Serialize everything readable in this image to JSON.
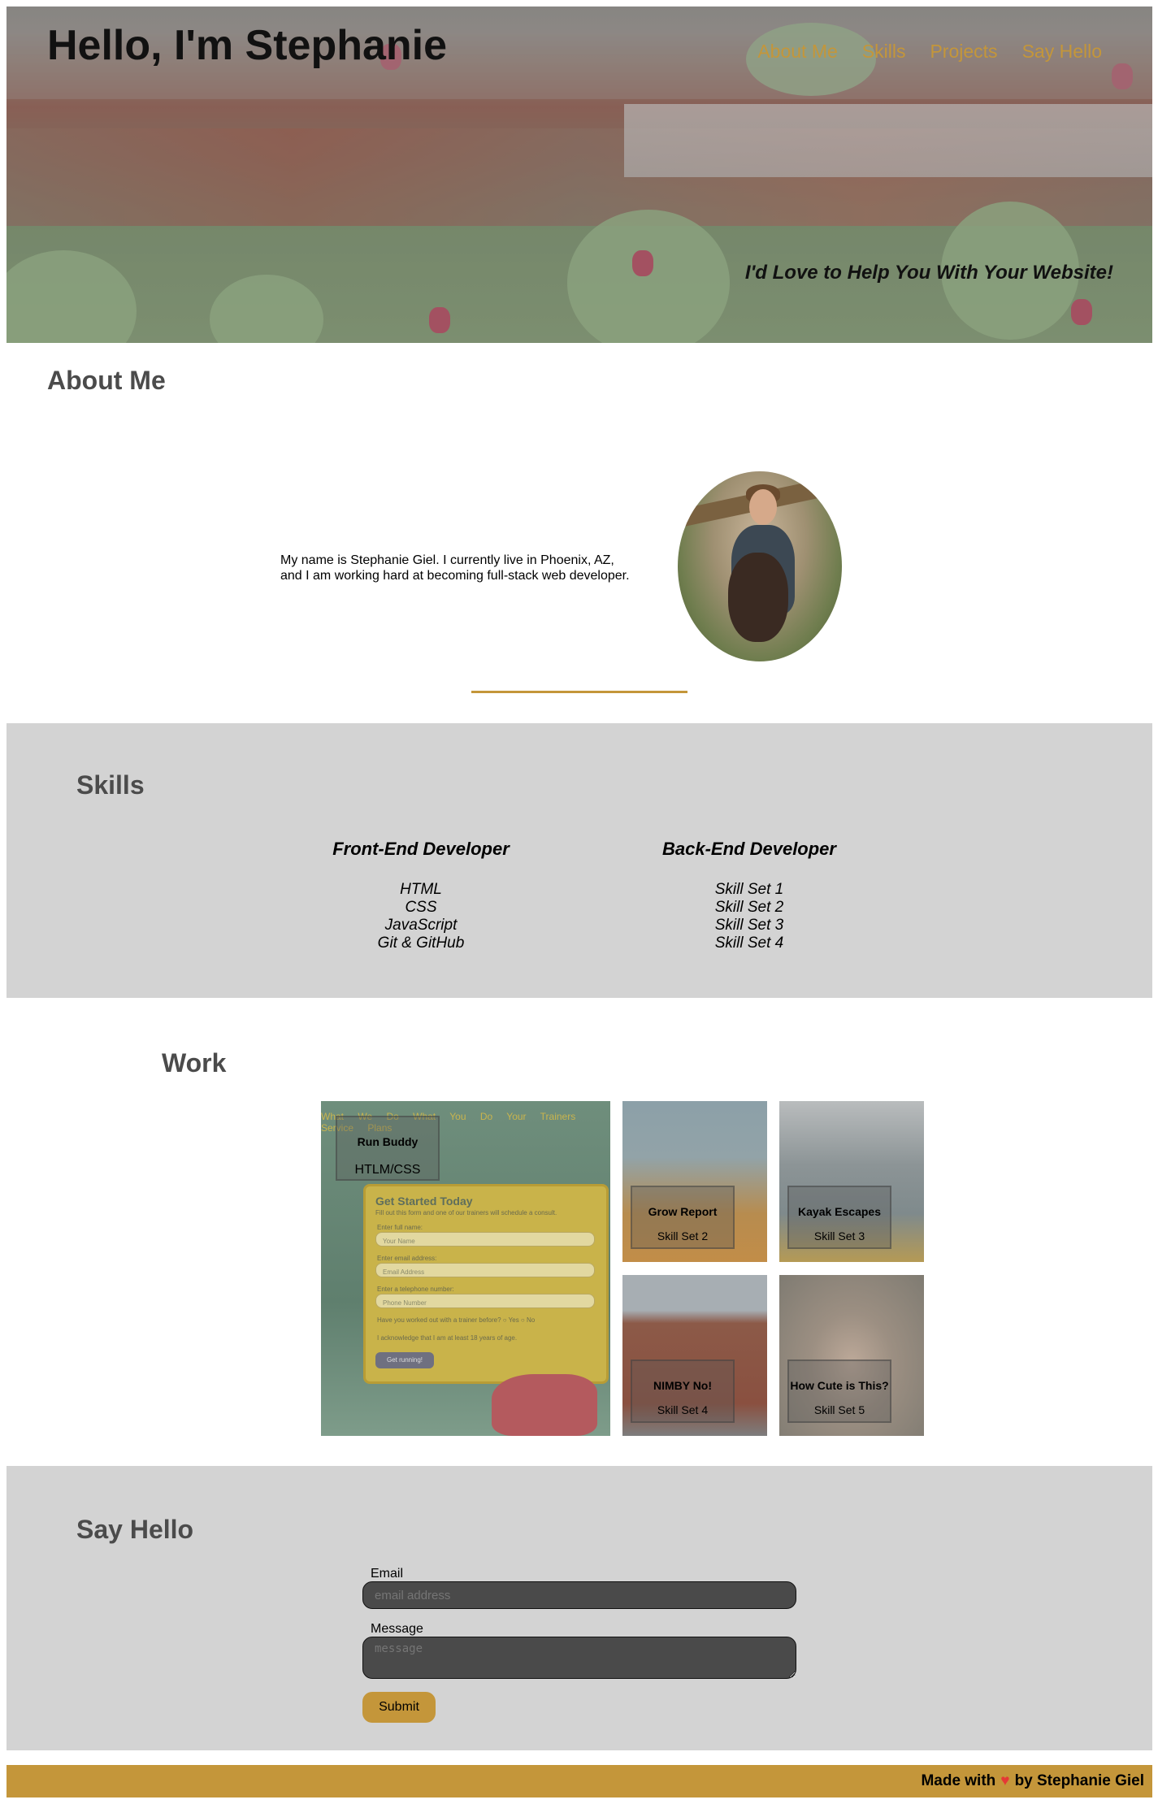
{
  "header": {
    "title": "Hello, I'm Stephanie",
    "nav": [
      "About Me",
      "Skills",
      "Projects",
      "Say Hello"
    ],
    "tagline": "I'd Love to Help You With Your Website!"
  },
  "about": {
    "heading": "About Me",
    "text": "My name is Stephanie Giel. I currently live in Phoenix, AZ, and I am working hard at becoming full-stack web developer."
  },
  "skills": {
    "heading": "Skills",
    "front": {
      "title": "Front-End Developer",
      "items": [
        "HTML",
        "CSS",
        "JavaScript",
        "Git & GitHub"
      ]
    },
    "back": {
      "title": "Back-End Developer",
      "items": [
        "Skill Set 1",
        "Skill Set 2",
        "Skill Set 3",
        "Skill Set 4"
      ]
    }
  },
  "work": {
    "heading": "Work",
    "projects": [
      {
        "title": "Run Buddy",
        "subtitle": "HTLM/CSS"
      },
      {
        "title": "Grow Report",
        "subtitle": "Skill Set 2"
      },
      {
        "title": "Kayak Escapes",
        "subtitle": "Skill Set 3"
      },
      {
        "title": "NIMBY No!",
        "subtitle": "Skill Set 4"
      },
      {
        "title": "How Cute is This?",
        "subtitle": "Skill Set 5"
      }
    ],
    "runbuddy_preview": {
      "nav": "What We Do  What You Do  Your Trainers  Service Plans",
      "form_title": "Get Started Today",
      "form_sub": "Fill out this form and one of our trainers will schedule a consult.",
      "labels": [
        "Enter full name:",
        "Enter email address:",
        "Enter a telephone number:"
      ],
      "placeholders": [
        "Your Name",
        "Email Address",
        "Phone Number"
      ],
      "question": "Have you worked out with a trainer before?  ○ Yes  ○ No",
      "ack": "I acknowledge that I am at least 18 years of age.",
      "button": "Get running!"
    }
  },
  "hello": {
    "heading": "Say Hello",
    "email_label": "Email",
    "email_placeholder": "email address",
    "message_label": "Message",
    "message_placeholder": "message",
    "submit": "Submit"
  },
  "footer": {
    "pre": "Made with",
    "heart": "♥",
    "post": "by Stephanie Giel"
  },
  "colors": {
    "accent": "#c4963a",
    "panel": "#d3d3d3",
    "heading": "#4b4b4b",
    "heart": "#e53935"
  }
}
